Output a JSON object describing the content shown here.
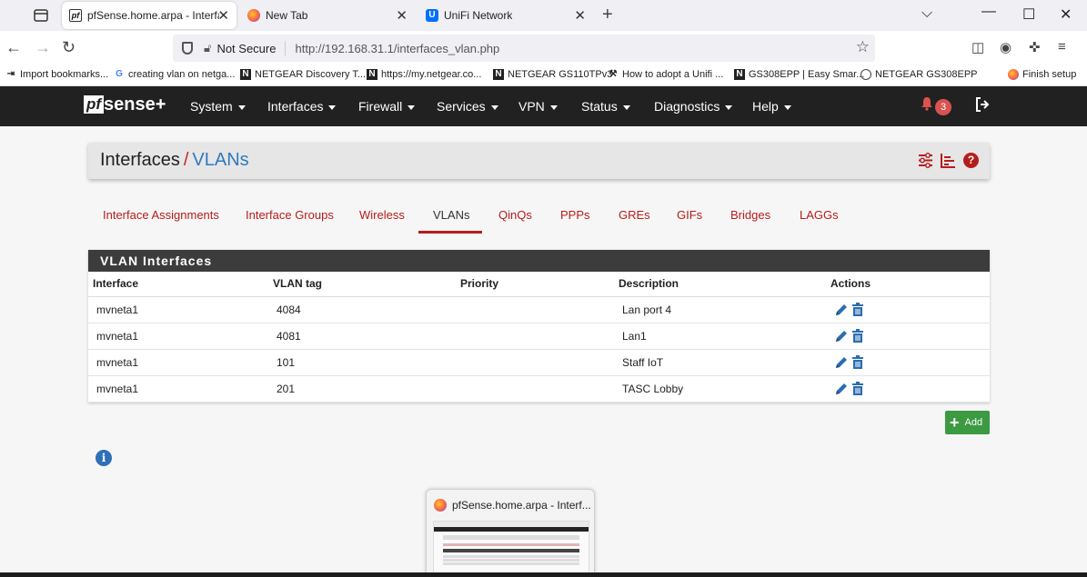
{
  "browser": {
    "tabs": [
      {
        "title": "pfSense.home.arpa - Interfaces: VLANs",
        "active": true,
        "icon": "pfsense-favicon"
      },
      {
        "title": "New Tab",
        "active": false,
        "icon": "firefox-favicon"
      },
      {
        "title": "UniFi Network",
        "active": false,
        "icon": "unifi-favicon"
      }
    ],
    "security_label": "Not Secure",
    "url": "http://192.168.31.1/interfaces_vlan.php",
    "bookmarks": [
      {
        "label": "Import bookmarks...",
        "icon": "import-icon"
      },
      {
        "label": "creating vlan on netga...",
        "icon": "google-icon"
      },
      {
        "label": "NETGEAR Discovery T...",
        "icon": "netgear-icon"
      },
      {
        "label": "https://my.netgear.co...",
        "icon": "netgear-icon"
      },
      {
        "label": "NETGEAR GS110TPv3",
        "icon": "netgear-icon"
      },
      {
        "label": "How to adopt a Unifi ...",
        "icon": "tool-icon"
      },
      {
        "label": "GS308EPP | Easy Smar...",
        "icon": "netgear-icon"
      },
      {
        "label": "NETGEAR GS308EPP",
        "icon": "globe-icon"
      },
      {
        "label": "Finish setup",
        "icon": "firefox-icon"
      }
    ]
  },
  "pfsense": {
    "logo_pf": "pf",
    "logo_sense": "sense+",
    "menu": [
      "System",
      "Interfaces",
      "Firewall",
      "Services",
      "VPN",
      "Status",
      "Diagnostics",
      "Help"
    ],
    "notification_count": "3"
  },
  "breadcrumb": {
    "section": "Interfaces",
    "page": "VLANs"
  },
  "subtabs": [
    {
      "label": "Interface Assignments",
      "active": false
    },
    {
      "label": "Interface Groups",
      "active": false
    },
    {
      "label": "Wireless",
      "active": false
    },
    {
      "label": "VLANs",
      "active": true
    },
    {
      "label": "QinQs",
      "active": false
    },
    {
      "label": "PPPs",
      "active": false
    },
    {
      "label": "GREs",
      "active": false
    },
    {
      "label": "GIFs",
      "active": false
    },
    {
      "label": "Bridges",
      "active": false
    },
    {
      "label": "LAGGs",
      "active": false
    }
  ],
  "vlan_panel": {
    "title": "VLAN Interfaces",
    "columns": [
      "Interface",
      "VLAN tag",
      "Priority",
      "Description",
      "Actions"
    ],
    "rows": [
      {
        "interface": "mvneta1",
        "tag": "4084",
        "priority": "",
        "description": "Lan port 4"
      },
      {
        "interface": "mvneta1",
        "tag": "4081",
        "priority": "",
        "description": "Lan1"
      },
      {
        "interface": "mvneta1",
        "tag": "101",
        "priority": "",
        "description": "Staff IoT"
      },
      {
        "interface": "mvneta1",
        "tag": "201",
        "priority": "",
        "description": "TASC Lobby"
      }
    ],
    "add_label": "Add"
  },
  "taskbar_preview": {
    "title": "pfSense.home.arpa - Interf..."
  },
  "colors": {
    "accent_red": "#b71c1c",
    "link_blue": "#2f7abf",
    "header_dark": "#212121",
    "add_green": "#3c9a42"
  }
}
